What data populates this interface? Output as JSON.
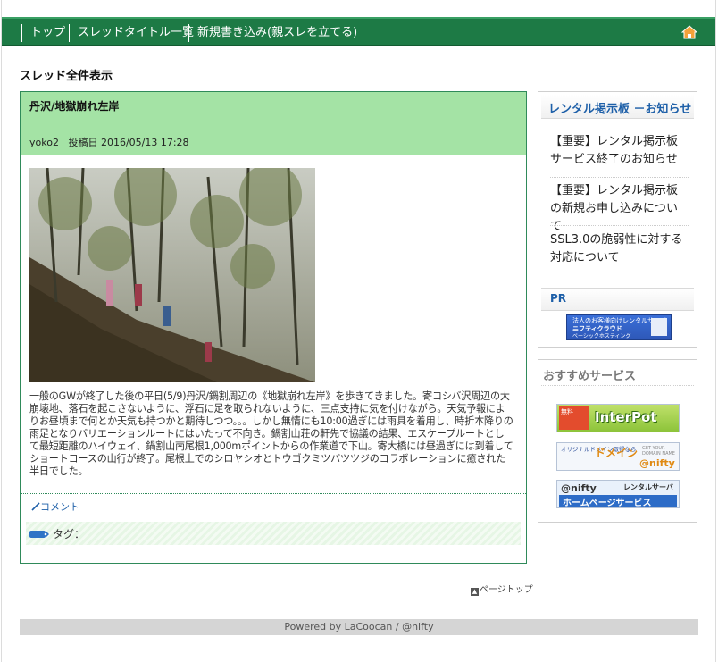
{
  "nav": {
    "items": [
      "トップ",
      "スレッドタイトル一覧",
      "新規書き込み(親スレを立てる)"
    ]
  },
  "section_title": "スレッド全件表示",
  "post": {
    "title": "丹沢/地獄崩れ左岸",
    "author": "yoko2",
    "date_label": "投稿日",
    "date": "2016/05/13 17:28",
    "body": "一般のGWが終了した後の平日(5/9)丹沢/鍋割周辺の《地獄崩れ左岸》を歩きてきました。寄コシバ沢周辺の大崩壊地、落石を起こさないように、浮石に足を取られないように、三点支持に気を付けながら。天気予報によりお昼頃まで何とか天気も持つかと期待しつつ。。。しかし無情にも10:00過ぎには雨具を着用し、時折本降りの雨足となりバリエーションルートにはいたって不向き。鍋割山荘の軒先で協議の結果、エスケープルートとして最短距離のハイウェイ、鍋割山南尾根1,000mポイントからの作業道で下山。寄大橋には昼過ぎには到着してショートコースの山行が終了。尾根上でのシロヤシオとトウゴクミツバツツジのコラボレーションに癒された半日でした。",
    "comment_label": "コメント",
    "tag_label": "タグ："
  },
  "page_top": "ページトップ",
  "sidebar": {
    "news_title": "レンタル掲示板 －お知らせ",
    "news_items": [
      "【重要】レンタル掲示板サービス終了のお知らせ",
      "【重要】レンタル掲示板の新規お申し込みについて",
      "SSL3.0の脆弱性に対する対応について"
    ],
    "pr_title": "PR",
    "pr_banner": {
      "line1": "法人のお客様向けレンタルサーバー",
      "line2": "ニフティクラウド",
      "line3": "ベーシックホスティング"
    },
    "services_title": "おすすめサービス",
    "banners": {
      "interpot": "InterPot",
      "interpot_tag": "無料",
      "domain_left": "オリジナルドメイン取得なら",
      "domain_main": "ドメイン",
      "domain_sub": "GET YOUR DOMAIN NAME",
      "domain_brand": "@nifty",
      "hp_brand": "@nifty",
      "hp_rental": "レンタルサーバー",
      "hp_service": "ホームページサービス"
    }
  },
  "footer": "Powered by LaCoocan / @nifty",
  "colors": {
    "nav_bg": "#1d7a45",
    "post_header_bg": "#a4e3a5",
    "accent_blue": "#1d5fa8"
  }
}
